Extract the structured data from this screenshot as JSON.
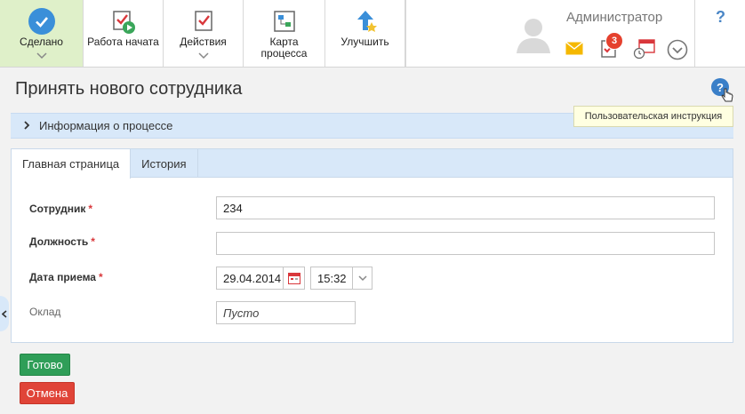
{
  "toolbar": {
    "done": "Сделано",
    "work_started": "Работа начата",
    "actions": "Действия",
    "process_map_line1": "Карта",
    "process_map_line2": "процесса",
    "improve": "Улучшить",
    "help": "?"
  },
  "user": {
    "name": "Администратор",
    "task_count": "3"
  },
  "page": {
    "title": "Принять нового сотрудника",
    "help": "?",
    "tooltip": "Пользовательская инструкция",
    "process_info": "Информация о процессе"
  },
  "tabs": [
    {
      "label": "Главная страница",
      "active": true
    },
    {
      "label": "История",
      "active": false
    }
  ],
  "form": {
    "employee_label": "Сотрудник",
    "employee_value": "234",
    "position_label": "Должность",
    "position_value": "",
    "hire_date_label": "Дата приема",
    "hire_date_value": "29.04.2014",
    "hire_time_value": "15:32",
    "salary_label": "Оклад",
    "salary_value": "Пусто",
    "required_mark": "*"
  },
  "buttons": {
    "submit": "Готово",
    "cancel": "Отмена"
  },
  "colors": {
    "accent": "#3a8fd9",
    "done_bg": "#dff0c9",
    "submit": "#2f9e58",
    "cancel": "#e04438",
    "badge": "#e5412e"
  }
}
